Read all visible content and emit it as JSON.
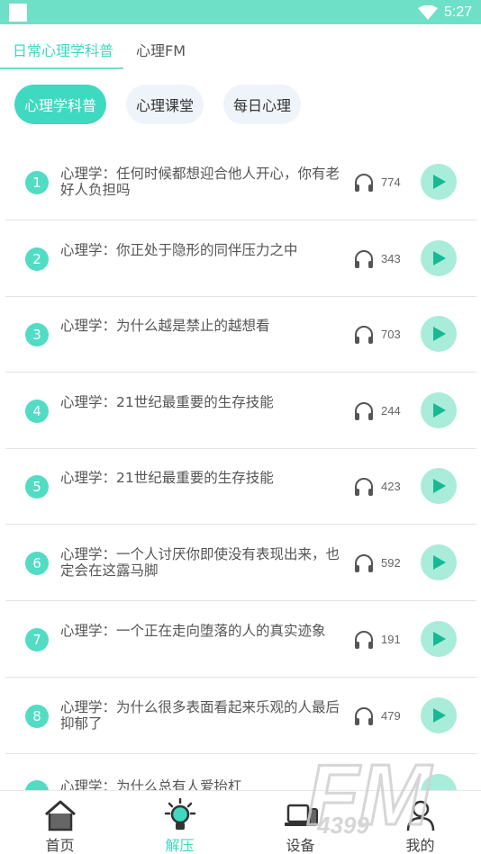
{
  "status_bar": {
    "time": "5:27"
  },
  "top_tabs": [
    {
      "label": "日常心理学科普",
      "active": true
    },
    {
      "label": "心理FM",
      "active": false
    }
  ],
  "category_pills": [
    {
      "label": "心理学科普",
      "active": true
    },
    {
      "label": "心理课堂",
      "active": false
    },
    {
      "label": "每日心理",
      "active": false
    }
  ],
  "items": [
    {
      "index": "1",
      "title": "心理学：任何时候都想迎合他人开心，你有老好人负担吗",
      "listens": "774"
    },
    {
      "index": "2",
      "title": "心理学：你正处于隐形的同伴压力之中",
      "listens": "343"
    },
    {
      "index": "3",
      "title": "心理学：为什么越是禁止的越想看",
      "listens": "703"
    },
    {
      "index": "4",
      "title": "心理学：21世纪最重要的生存技能",
      "listens": "244"
    },
    {
      "index": "5",
      "title": "心理学：21世纪最重要的生存技能",
      "listens": "423"
    },
    {
      "index": "6",
      "title": "心理学：一个人讨厌你即使没有表现出来，也定会在这露马脚",
      "listens": "592"
    },
    {
      "index": "7",
      "title": "心理学：一个正在走向堕落的人的真实迹象",
      "listens": "191"
    },
    {
      "index": "8",
      "title": "心理学：为什么很多表面看起来乐观的人最后抑郁了",
      "listens": "479"
    }
  ],
  "partial_item": {
    "title": "心理学：为什么总有人爱抬杠"
  },
  "bottom_nav": [
    {
      "label": "首页",
      "icon": "home-icon",
      "active": false
    },
    {
      "label": "解压",
      "icon": "lightbulb-icon",
      "active": true
    },
    {
      "label": "设备",
      "icon": "device-icon",
      "active": false
    },
    {
      "label": "我的",
      "icon": "person-icon",
      "active": false
    }
  ],
  "watermark": {
    "text_top": "FM",
    "text_bottom": "4399"
  },
  "colors": {
    "accent": "#3fd9c1",
    "status_bar": "#6fe0c8",
    "play_bg": "#a9ecd9",
    "play_icon": "#19b894"
  }
}
